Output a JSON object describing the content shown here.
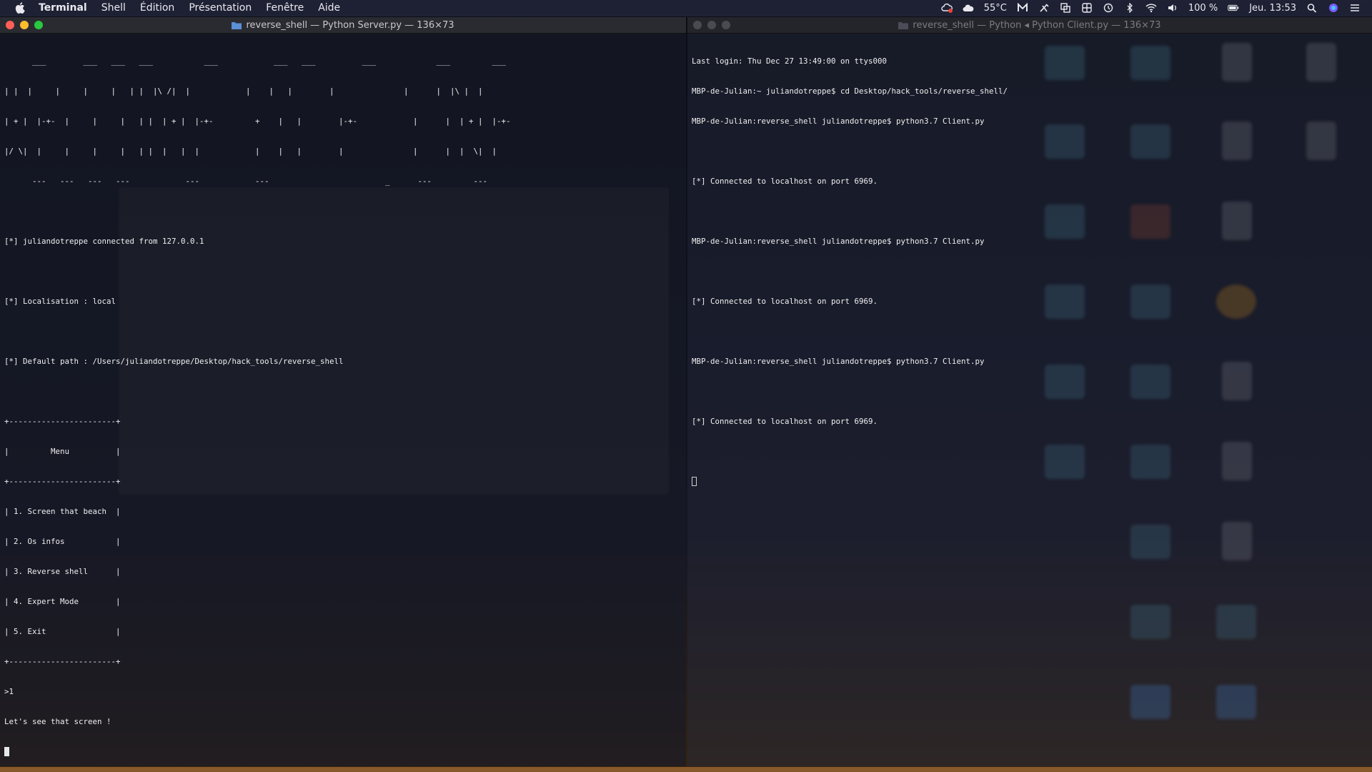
{
  "menubar": {
    "apple_icon": "apple-logo-icon",
    "app_name": "Terminal",
    "items": [
      "Shell",
      "Édition",
      "Présentation",
      "Fenêtre",
      "Aide"
    ],
    "status": {
      "temperature": "55°C",
      "battery": "100 %",
      "clock": "Jeu. 13:53"
    }
  },
  "left_window": {
    "title": "reverse_shell — Python Server.py — 136×73",
    "banner": [
      "      ___        ___   ___   ___           ___            ___   ___          ___             ___         ___",
      "| |  |     |     |     |   | |  |\\ /|  |            |    |   |        |               |      |  |\\ |  |",
      "| + |  |-+-  |     |     |   | |  | + |  |-+-         +    |   |        |-+-            |      |  | + |  |-+-",
      "|/ \\|  |     |     |     |   | |  |   |  |            |    |   |        |               |      |  |  \\|  |",
      "      ---   ---   ---   ---            ---            ---                         _      ---         ---"
    ],
    "lines": [
      "",
      "[*] juliandotreppe connected from 127.0.0.1",
      "",
      "[*] Localisation : local",
      "",
      "[*] Default path : /Users/juliandotreppe/Desktop/hack_tools/reverse_shell",
      "",
      "+-----------------------+",
      "|         Menu          |",
      "+-----------------------+",
      "| 1. Screen that beach  |",
      "| 2. Os infos           |",
      "| 3. Reverse shell      |",
      "| 4. Expert Mode        |",
      "| 5. Exit               |",
      "+-----------------------+",
      ">1",
      "Let's see that screen !"
    ]
  },
  "right_window": {
    "title": "reverse_shell — Python ◂ Python Client.py — 136×73",
    "lines": [
      "Last login: Thu Dec 27 13:49:00 on ttys000",
      "MBP-de-Julian:~ juliandotreppe$ cd Desktop/hack_tools/reverse_shell/",
      "MBP-de-Julian:reverse_shell juliandotreppe$ python3.7 Client.py",
      "",
      "[*] Connected to localhost on port 6969.",
      "",
      "MBP-de-Julian:reverse_shell juliandotreppe$ python3.7 Client.py",
      "",
      "[*] Connected to localhost on port 6969.",
      "",
      "MBP-de-Julian:reverse_shell juliandotreppe$ python3.7 Client.py",
      "",
      "[*] Connected to localhost on port 6969.",
      ""
    ]
  },
  "colors": {
    "close": "#ff5f57",
    "minimize": "#febc2e",
    "zoom": "#28c840",
    "terminal_text": "#f0f0f0"
  }
}
